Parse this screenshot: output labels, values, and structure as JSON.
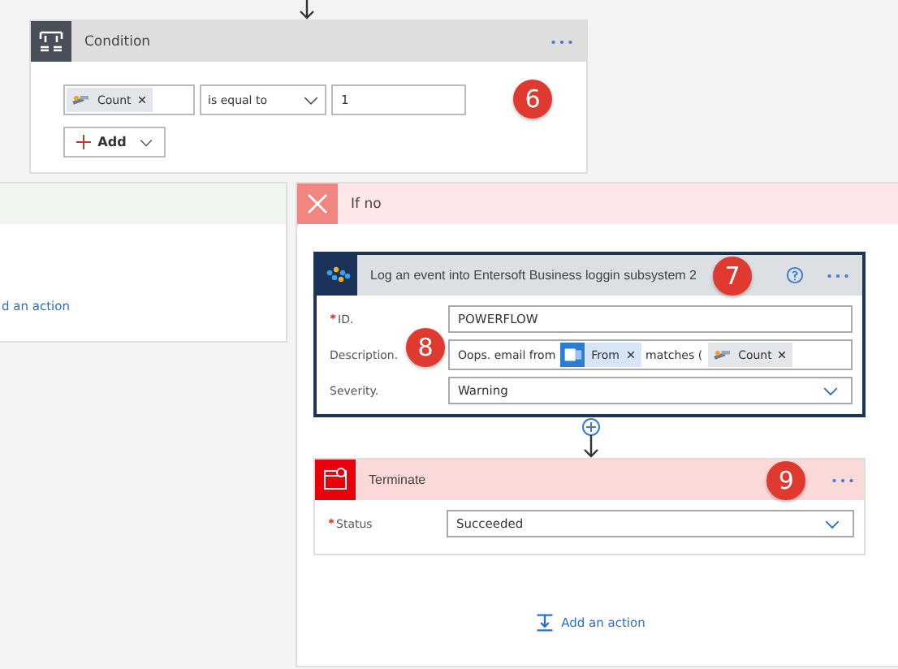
{
  "condition": {
    "title": "Condition",
    "operand": {
      "text": "Count"
    },
    "operator": "is equal to",
    "value": "1",
    "add_button": "Add",
    "callout": "6"
  },
  "yes_branch": {
    "add_action": "d an action"
  },
  "no_branch": {
    "title": "If no",
    "actions": [
      {
        "kind": "connector",
        "title": "Log an event into Entersoft Business loggin subsystem 2",
        "callout": "7",
        "fields": [
          {
            "kind": "text",
            "label": "ID.",
            "required": true,
            "value": "POWERFLOW"
          },
          {
            "kind": "tokens",
            "label": "Description.",
            "required": false,
            "callout": "8",
            "parts": [
              {
                "kind": "text",
                "text": "Oops. email from"
              },
              {
                "kind": "mail_token",
                "text": "From"
              },
              {
                "kind": "text",
                "text": "matches ("
              },
              {
                "kind": "variable_token",
                "text": "Count"
              }
            ]
          },
          {
            "kind": "dropdown",
            "label": "Severity.",
            "required": false,
            "value": "Warning"
          }
        ]
      },
      {
        "kind": "terminate",
        "title": "Terminate",
        "callout": "9",
        "fields": [
          {
            "kind": "dropdown",
            "label": "Status",
            "required": true,
            "value": "Succeeded"
          }
        ]
      }
    ],
    "add_action": "Add an action"
  }
}
